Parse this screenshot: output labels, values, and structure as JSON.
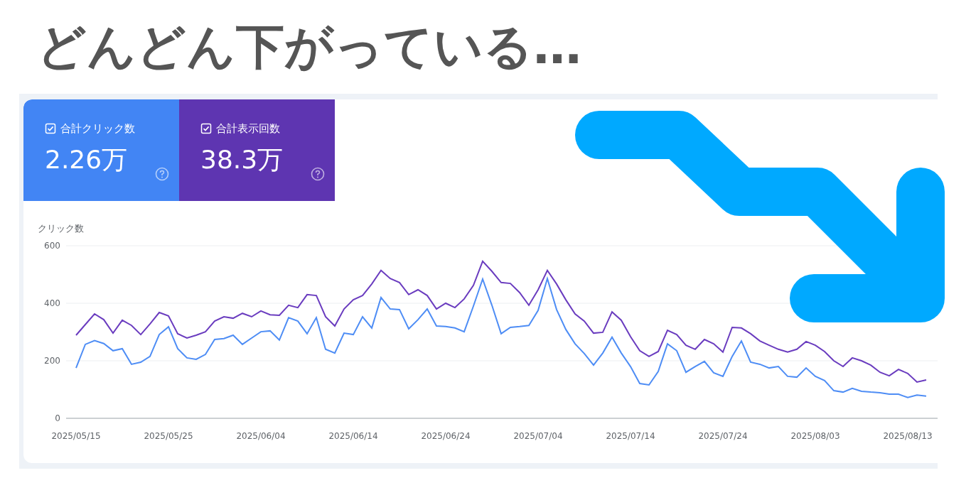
{
  "headline": "どんどん下がっている…",
  "metrics": [
    {
      "label": "合計クリック数",
      "value": "2.26万",
      "checked": true,
      "selected": true,
      "color": "#4285f4"
    },
    {
      "label": "合計表示回数",
      "value": "38.3万",
      "checked": true,
      "selected": true,
      "color": "#5e35b1"
    }
  ],
  "chart": {
    "chart_data": {
      "type": "line",
      "ylabel": "クリック数",
      "categories": [
        "2025/05/15",
        null,
        null,
        null,
        null,
        null,
        null,
        null,
        null,
        null,
        "2025/05/25",
        null,
        null,
        null,
        null,
        null,
        null,
        null,
        null,
        null,
        "2025/06/04",
        null,
        null,
        null,
        null,
        null,
        null,
        null,
        null,
        null,
        "2025/06/14",
        null,
        null,
        null,
        null,
        null,
        null,
        null,
        null,
        null,
        "2025/06/24",
        null,
        null,
        null,
        null,
        null,
        null,
        null,
        null,
        null,
        "2025/07/04",
        null,
        null,
        null,
        null,
        null,
        null,
        null,
        null,
        null,
        "2025/07/14",
        null,
        null,
        null,
        null,
        null,
        null,
        null,
        null,
        null,
        "2025/07/24",
        null,
        null,
        null,
        null,
        null,
        null,
        null,
        null,
        null,
        "2025/08/03",
        null,
        null,
        null,
        null,
        null,
        null,
        null,
        null,
        null,
        "2025/08/13",
        null,
        null
      ],
      "series": [
        {
          "color": "#4e8df5",
          "values": [
            175,
            257,
            270,
            260,
            235,
            242,
            188,
            195,
            215,
            291,
            318,
            242,
            210,
            205,
            222,
            274,
            277,
            289,
            257,
            279,
            301,
            304,
            272,
            350,
            338,
            294,
            350,
            240,
            227,
            296,
            291,
            353,
            314,
            420,
            380,
            378,
            311,
            343,
            380,
            321,
            319,
            314,
            301,
            390,
            484,
            393,
            294,
            316,
            319,
            323,
            375,
            486,
            378,
            309,
            259,
            225,
            185,
            227,
            282,
            227,
            180,
            121,
            116,
            163,
            259,
            235,
            160,
            180,
            198,
            158,
            146,
            215,
            269,
            195,
            188,
            175,
            180,
            146,
            143,
            175,
            146,
            131,
            96,
            91,
            104,
            94,
            91,
            89,
            84,
            84,
            72,
            81,
            77
          ]
        },
        {
          "color": "#6a3cbf",
          "values": [
            289,
            326,
            363,
            343,
            296,
            341,
            323,
            291,
            328,
            368,
            356,
            294,
            279,
            289,
            301,
            338,
            353,
            348,
            365,
            353,
            373,
            360,
            358,
            393,
            385,
            430,
            427,
            353,
            321,
            380,
            412,
            427,
            467,
            514,
            486,
            472,
            430,
            447,
            427,
            380,
            400,
            385,
            415,
            462,
            546,
            511,
            472,
            469,
            437,
            393,
            447,
            514,
            467,
            412,
            363,
            338,
            296,
            299,
            370,
            341,
            284,
            235,
            215,
            232,
            306,
            291,
            254,
            240,
            274,
            259,
            230,
            316,
            314,
            294,
            269,
            254,
            240,
            230,
            240,
            267,
            254,
            232,
            200,
            180,
            210,
            200,
            185,
            160,
            148,
            170,
            156,
            126,
            133
          ]
        }
      ],
      "ylim": [
        0,
        600
      ],
      "yticks": [
        0,
        200,
        400,
        600
      ]
    }
  }
}
